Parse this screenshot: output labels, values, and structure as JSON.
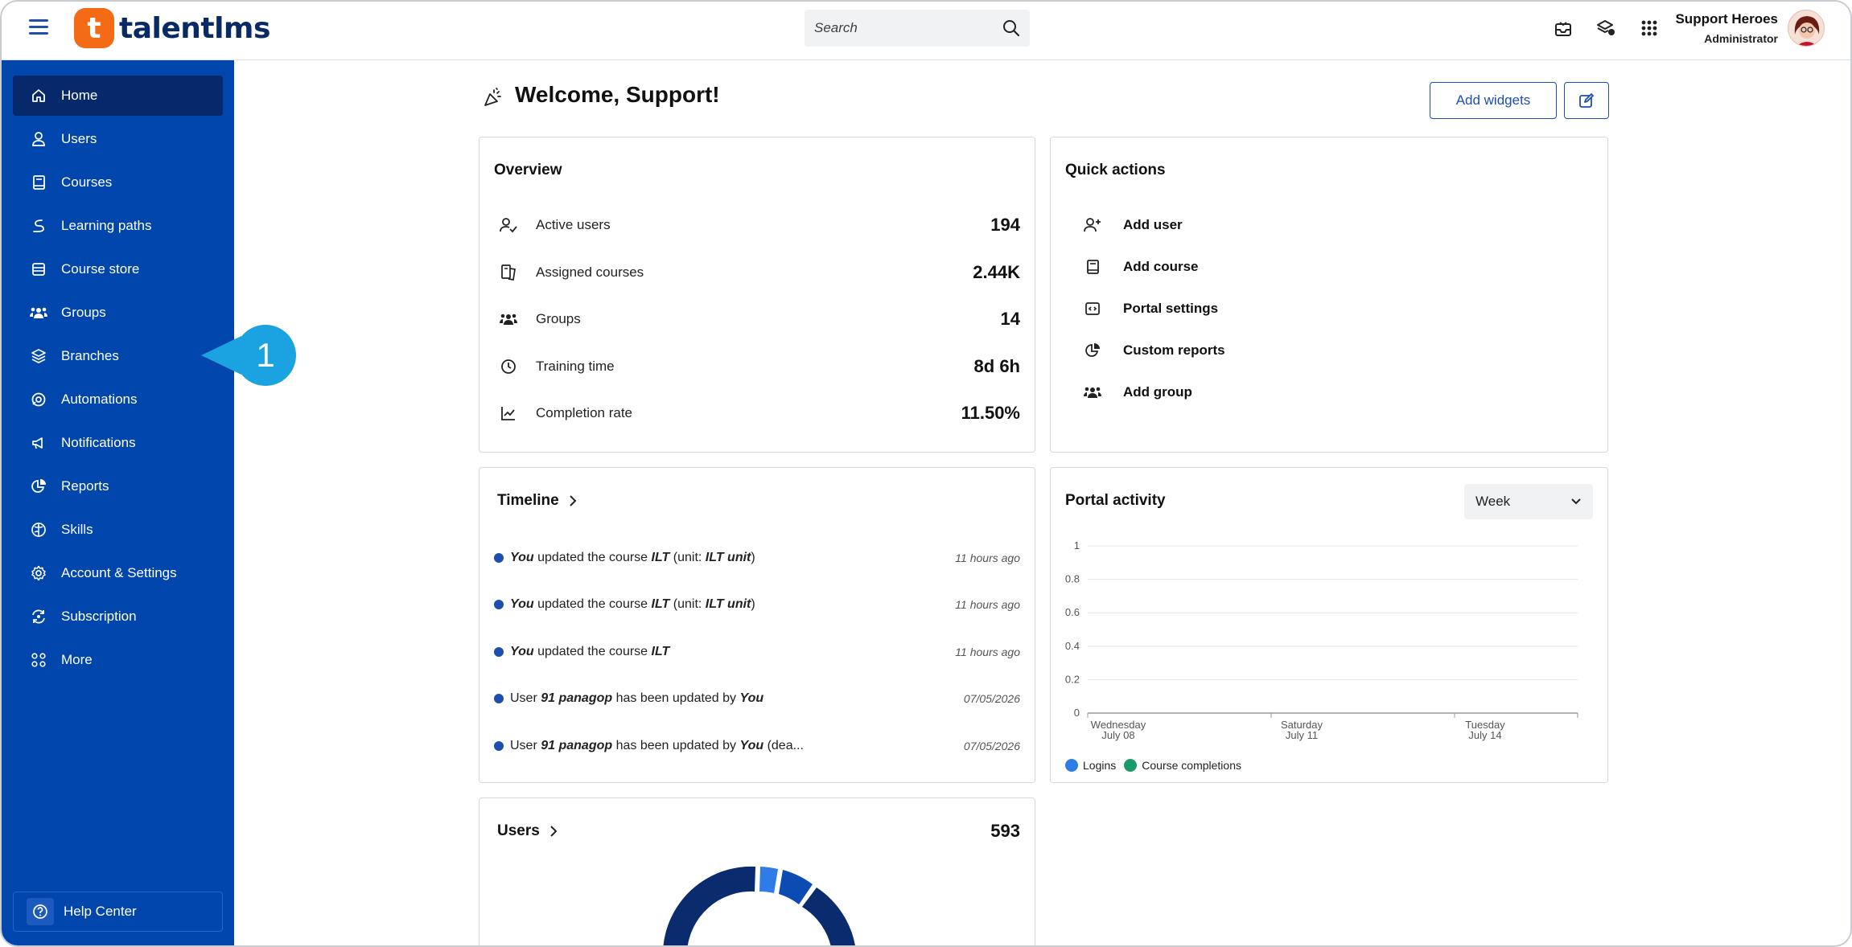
{
  "header": {
    "search_placeholder": "Search",
    "user_name": "Support Heroes",
    "user_role": "Administrator"
  },
  "logo": {
    "mark": "t",
    "text": "talentlms"
  },
  "sidebar": {
    "items": [
      {
        "label": "Home",
        "icon": "home-icon",
        "active": true
      },
      {
        "label": "Users",
        "icon": "user-icon"
      },
      {
        "label": "Courses",
        "icon": "book-icon"
      },
      {
        "label": "Learning paths",
        "icon": "path-icon"
      },
      {
        "label": "Course store",
        "icon": "store-icon"
      },
      {
        "label": "Groups",
        "icon": "groups-icon"
      },
      {
        "label": "Branches",
        "icon": "layers-icon"
      },
      {
        "label": "Automations",
        "icon": "automation-icon"
      },
      {
        "label": "Notifications",
        "icon": "megaphone-icon"
      },
      {
        "label": "Reports",
        "icon": "pie-chart-icon"
      },
      {
        "label": "Skills",
        "icon": "brain-icon"
      },
      {
        "label": "Account & Settings",
        "icon": "gear-icon"
      },
      {
        "label": "Subscription",
        "icon": "subscription-icon"
      },
      {
        "label": "More",
        "icon": "grid-dots-icon"
      }
    ],
    "help_label": "Help Center"
  },
  "callout": {
    "number": "1"
  },
  "main": {
    "welcome": "Welcome, Support!",
    "add_widgets_label": "Add widgets"
  },
  "overview": {
    "title": "Overview",
    "rows": [
      {
        "label": "Active users",
        "value": "194"
      },
      {
        "label": "Assigned courses",
        "value": "2.44K"
      },
      {
        "label": "Groups",
        "value": "14"
      },
      {
        "label": "Training time",
        "value": "8d 6h"
      },
      {
        "label": "Completion rate",
        "value": "11.50%"
      }
    ]
  },
  "quick_actions": {
    "title": "Quick actions",
    "items": [
      "Add user",
      "Add course",
      "Portal settings",
      "Custom reports",
      "Add group"
    ]
  },
  "timeline": {
    "title": "Timeline",
    "items": [
      {
        "time": "11 hours ago"
      },
      {
        "time": "11 hours ago"
      },
      {
        "time": "11 hours ago"
      },
      {
        "time": "07/05/2026"
      },
      {
        "time": "07/05/2026"
      }
    ],
    "text": {
      "you": "You",
      "updated_course": " updated the course ",
      "ilt": "ILT",
      "unit_open": " (unit: ",
      "ilt_unit": "ILT unit",
      "unit_close": ")",
      "user": "User ",
      "username": "91 panagop",
      "updated_by": " has been updated by ",
      "truncated": " (dea..."
    }
  },
  "portal_activity": {
    "title": "Portal activity",
    "period": "Week",
    "legend": [
      "Logins",
      "Course completions"
    ],
    "x_ticks": [
      {
        "day": "Wednesday",
        "date": "July 08"
      },
      {
        "day": "Saturday",
        "date": "July 11"
      },
      {
        "day": "Tuesday",
        "date": "July 14"
      }
    ]
  },
  "chart_data": {
    "type": "line",
    "title": "Portal activity",
    "x": [
      "Wednesday July 08",
      "Saturday July 11",
      "Tuesday July 14"
    ],
    "series": [
      {
        "name": "Logins",
        "values": [
          0,
          0,
          0
        ],
        "color": "#2f7ce8"
      },
      {
        "name": "Course completions",
        "values": [
          0,
          0,
          0
        ],
        "color": "#1a9a6b"
      }
    ],
    "ylim": [
      0,
      1
    ],
    "y_ticks": [
      "1",
      "0.8",
      "0.6",
      "0.4",
      "0.2",
      "0"
    ],
    "grid": true,
    "legend_position": "bottom-left"
  },
  "users_card": {
    "title": "Users",
    "total": "593"
  },
  "colors": {
    "sidebar": "#0046ad",
    "sidebar_active": "#05296b",
    "accent": "#1e4fae",
    "logo": "#f46a15",
    "callout": "#1aa3e0"
  }
}
